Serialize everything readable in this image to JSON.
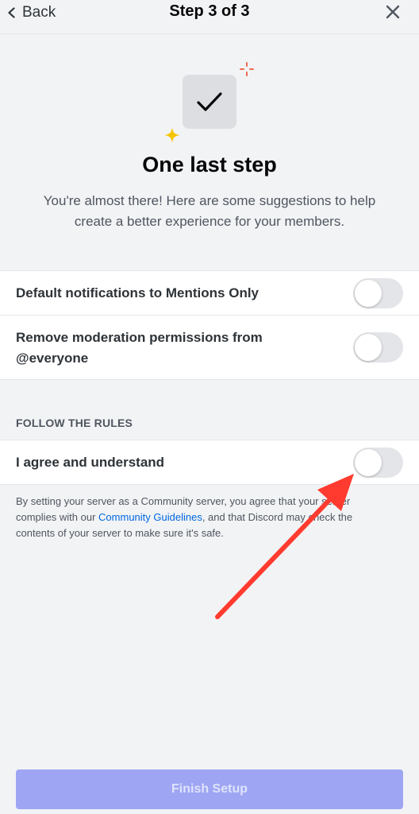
{
  "header": {
    "back_label": "Back",
    "title": "Step 3 of 3",
    "back_icon": "chevron-left-icon",
    "close_icon": "close-icon"
  },
  "hero": {
    "icon": "checkmark-icon",
    "title": "One last step",
    "subtitle": "You're almost there! Here are some suggestions to help create a better experience for your members."
  },
  "settings": {
    "rows": [
      {
        "label": "Default notifications to Mentions Only",
        "enabled": false
      },
      {
        "label": "Remove moderation permissions from @everyone",
        "enabled": false
      }
    ]
  },
  "rules": {
    "section_title": "FOLLOW THE RULES",
    "agree_label": "I agree and understand",
    "agree_enabled": false,
    "footnote_before": "By setting your server as a Community server, you agree that your server complies with our ",
    "footnote_link": "Community Guidelines",
    "footnote_after": ", and that Discord may check the contents of your server to make sure it's safe."
  },
  "footer": {
    "finish_label": "Finish Setup",
    "finish_disabled": true
  },
  "colors": {
    "background": "#f2f3f5",
    "button_disabled": "#9ea6f3",
    "link": "#0068e0",
    "annotation_arrow": "#ff3b2f",
    "sparkle_red": "#f06b4f",
    "sparkle_yellow": "#f5c400"
  }
}
